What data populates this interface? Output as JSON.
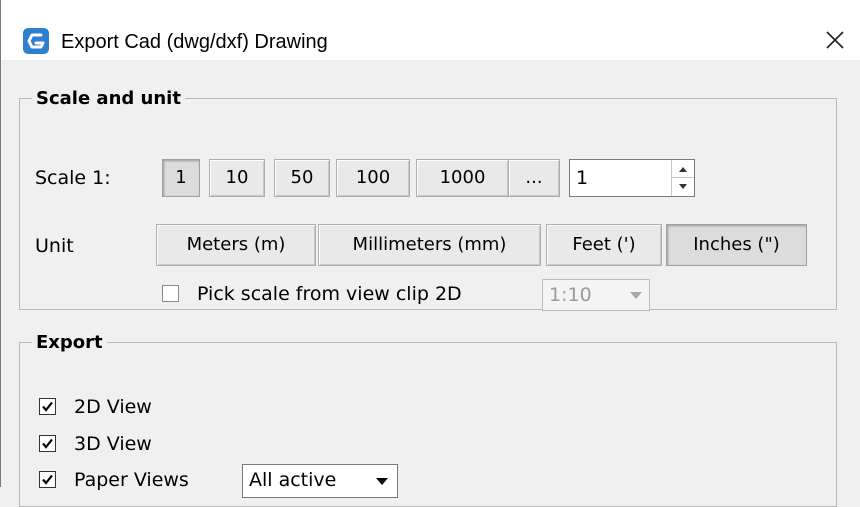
{
  "window": {
    "title": "Export Cad (dwg/dxf) Drawing",
    "icon": "app-logo-icon",
    "close_icon": "close-icon"
  },
  "scale_unit": {
    "legend": "Scale and unit",
    "scale_label": "Scale 1:",
    "scale_buttons": [
      {
        "label": "1",
        "active": true
      },
      {
        "label": "10",
        "active": false
      },
      {
        "label": "50",
        "active": false
      },
      {
        "label": "100",
        "active": false
      },
      {
        "label": "1000",
        "active": false
      },
      {
        "label": "...",
        "active": false
      }
    ],
    "scale_value": "1",
    "unit_label": "Unit",
    "unit_buttons": [
      {
        "label": "Meters (m)",
        "active": false
      },
      {
        "label": "Millimeters (mm)",
        "active": false
      },
      {
        "label": "Feet (')",
        "active": false
      },
      {
        "label": "Inches (\")",
        "active": true
      }
    ],
    "pick_scale": {
      "label": "Pick scale from view clip 2D",
      "checked": false,
      "select_value": "1:10",
      "select_enabled": false
    }
  },
  "export": {
    "legend": "Export",
    "options": [
      {
        "label": "2D View",
        "checked": true
      },
      {
        "label": "3D View",
        "checked": true
      },
      {
        "label": "Paper Views",
        "checked": true
      }
    ],
    "paper_views_select": "All active"
  }
}
